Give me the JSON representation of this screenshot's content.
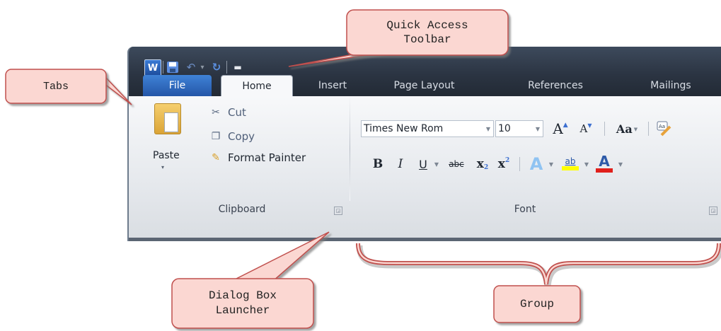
{
  "callouts": {
    "quick_access": "Quick Access\nToolbar",
    "tabs": "Tabs",
    "dialog_box_launcher": "Dialog Box\nLauncher",
    "group": "Group"
  },
  "qat": {
    "app_icon_letter": "W"
  },
  "tabs": [
    {
      "label": "File"
    },
    {
      "label": "Home"
    },
    {
      "label": "Insert"
    },
    {
      "label": "Page Layout"
    },
    {
      "label": "References"
    },
    {
      "label": "Mailings"
    }
  ],
  "clipboard": {
    "paste_label": "Paste",
    "cut_label": "Cut",
    "copy_label": "Copy",
    "format_painter_label": "Format Painter",
    "group_label": "Clipboard"
  },
  "font": {
    "font_name": "Times New Rom",
    "font_size": "10",
    "group_label": "Font",
    "buttons": {
      "grow": "A",
      "shrink": "A",
      "change_case": "Aa",
      "bold": "B",
      "italic": "I",
      "underline": "U",
      "strikethrough": "abc",
      "subscript": "x",
      "superscript": "x",
      "text_effects": "A",
      "highlight": "ab",
      "font_color": "A"
    }
  },
  "colors": {
    "file_tab": "#2f6cc4",
    "callout_fill": "#fbd7d2",
    "callout_border": "#c0504d",
    "highlight": "#ffff00",
    "font_color_bar": "#e0201b"
  }
}
